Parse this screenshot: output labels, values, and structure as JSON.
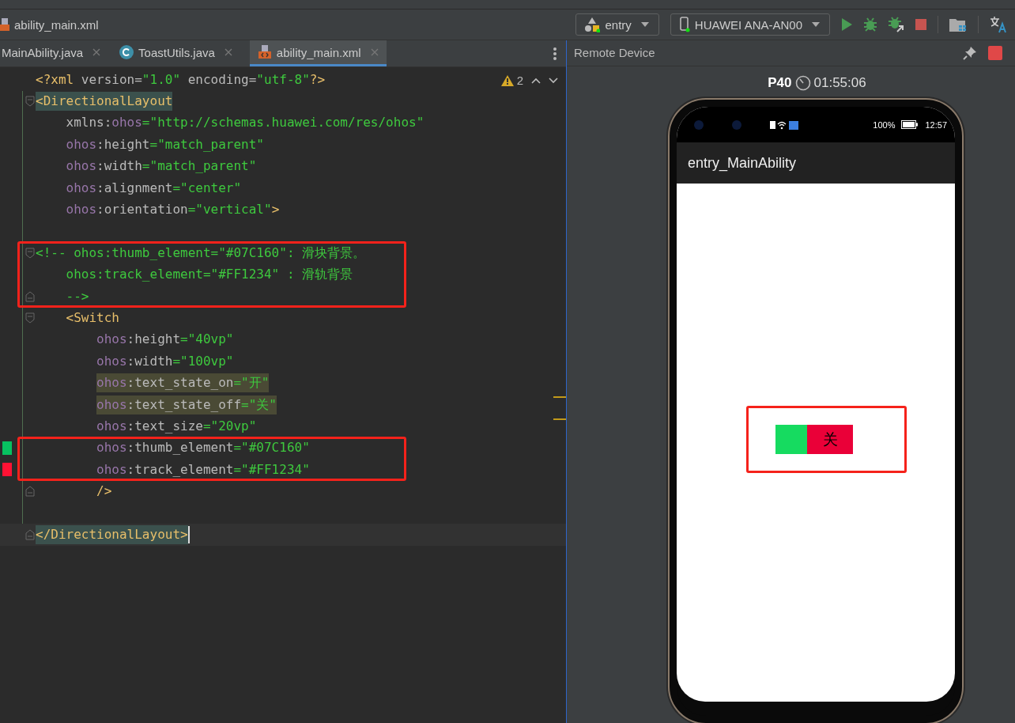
{
  "breadcrumb": {
    "file": "ability_main.xml"
  },
  "toolbar": {
    "run_config": "entry",
    "device": "HUAWEI ANA-AN00"
  },
  "tabs": [
    {
      "label": "MainAbility.java",
      "kind": "java",
      "selected": false
    },
    {
      "label": "ToastUtils.java",
      "kind": "class",
      "selected": false
    },
    {
      "label": "ability_main.xml",
      "kind": "xml",
      "selected": true
    }
  ],
  "editor": {
    "warnings": "2",
    "segments": [
      {
        "boxed": false,
        "lines": [
          {
            "tokens": [
              {
                "kind": "punct",
                "text": "<?xml "
              },
              {
                "kind": "attr",
                "text": "version="
              },
              {
                "kind": "str",
                "text": "\"1.0\""
              },
              {
                "kind": "attr",
                "text": " encoding="
              },
              {
                "kind": "str",
                "text": "\"utf-8\""
              },
              {
                "kind": "punct",
                "text": "?>"
              }
            ]
          },
          {
            "fold_start": true,
            "tag_highlight": true,
            "tokens": [
              {
                "kind": "tag",
                "text": "<DirectionalLayout"
              }
            ]
          },
          {
            "tokens": [
              {
                "kind": "attr",
                "text": "    xmlns:"
              },
              {
                "kind": "ns",
                "text": "ohos"
              },
              {
                "kind": "str",
                "text": "=\"http://schemas.huawei.com/res/ohos\""
              }
            ]
          },
          {
            "tokens": [
              {
                "kind": "ns",
                "text": "    ohos"
              },
              {
                "kind": "attr",
                "text": ":height"
              },
              {
                "kind": "str",
                "text": "=\"match_parent\""
              }
            ]
          },
          {
            "tokens": [
              {
                "kind": "ns",
                "text": "    ohos"
              },
              {
                "kind": "attr",
                "text": ":width"
              },
              {
                "kind": "str",
                "text": "=\"match_parent\""
              }
            ]
          },
          {
            "tokens": [
              {
                "kind": "ns",
                "text": "    ohos"
              },
              {
                "kind": "attr",
                "text": ":alignment"
              },
              {
                "kind": "str",
                "text": "=\"center\""
              }
            ]
          },
          {
            "space_after": true,
            "tokens": [
              {
                "kind": "ns",
                "text": "    ohos"
              },
              {
                "kind": "attr",
                "text": ":orientation"
              },
              {
                "kind": "str",
                "text": "=\"vertical\""
              },
              {
                "kind": "tag",
                "text": ">"
              }
            ]
          }
        ]
      },
      {
        "boxed": true,
        "lines": [
          {
            "fold_start": true,
            "tokens": [
              {
                "kind": "comment",
                "text": "<!-- ohos:thumb_element=\"#07C160\": 滑块背景。"
              }
            ]
          },
          {
            "tokens": [
              {
                "kind": "comment",
                "text": "    ohos:track_element=\"#FF1234\" : 滑轨背景"
              }
            ]
          },
          {
            "fold_end": true,
            "tokens": [
              {
                "kind": "comment",
                "text": "    -->"
              }
            ]
          }
        ]
      },
      {
        "boxed": false,
        "lines": [
          {
            "fold_start": true,
            "tokens": [
              {
                "kind": "tag",
                "text": "    <Switch"
              }
            ]
          },
          {
            "tokens": [
              {
                "kind": "ns",
                "text": "        ohos"
              },
              {
                "kind": "attr",
                "text": ":height"
              },
              {
                "kind": "str",
                "text": "=\"40vp\""
              }
            ]
          },
          {
            "tokens": [
              {
                "kind": "ns",
                "text": "        ohos"
              },
              {
                "kind": "attr",
                "text": ":width"
              },
              {
                "kind": "str",
                "text": "=\"100vp\""
              }
            ]
          },
          {
            "usage_highlight": true,
            "tokens": [
              {
                "kind": "ns",
                "text": "        ohos"
              },
              {
                "kind": "attr",
                "text": ":text_state_on"
              },
              {
                "kind": "str",
                "text": "=\"开\""
              }
            ]
          },
          {
            "usage_highlight": true,
            "tokens": [
              {
                "kind": "ns",
                "text": "        ohos"
              },
              {
                "kind": "attr",
                "text": ":text_state_off"
              },
              {
                "kind": "str",
                "text": "=\"关\""
              }
            ]
          },
          {
            "tokens": [
              {
                "kind": "ns",
                "text": "        ohos"
              },
              {
                "kind": "attr",
                "text": ":text_size"
              },
              {
                "kind": "str",
                "text": "=\"20vp\""
              }
            ]
          }
        ]
      },
      {
        "boxed": true,
        "lines": [
          {
            "color": "#07c160",
            "tokens": [
              {
                "kind": "ns",
                "text": "        ohos"
              },
              {
                "kind": "attr",
                "text": ":thumb_element"
              },
              {
                "kind": "str",
                "text": "=\"#07C160\""
              }
            ]
          },
          {
            "color": "#ff1234",
            "tokens": [
              {
                "kind": "ns",
                "text": "        ohos"
              },
              {
                "kind": "attr",
                "text": ":track_element"
              },
              {
                "kind": "str",
                "text": "=\"#FF1234\""
              }
            ]
          }
        ]
      },
      {
        "boxed": false,
        "lines": [
          {
            "fold_end": true,
            "space_after": true,
            "tokens": [
              {
                "kind": "tag",
                "text": "        />"
              }
            ]
          },
          {
            "fold_end": true,
            "tag_highlight": true,
            "current": true,
            "tokens": [
              {
                "kind": "tag",
                "text": "</DirectionalLayout>"
              }
            ]
          }
        ]
      }
    ]
  },
  "remote_panel": {
    "title": "Remote Device",
    "model": "P40",
    "timer": "01:55:06",
    "phone": {
      "battery": "100%",
      "clock": "12:57",
      "app_title": "entry_MainAbility",
      "switch": {
        "on": false,
        "state_text": "关",
        "boxed": true
      }
    }
  }
}
